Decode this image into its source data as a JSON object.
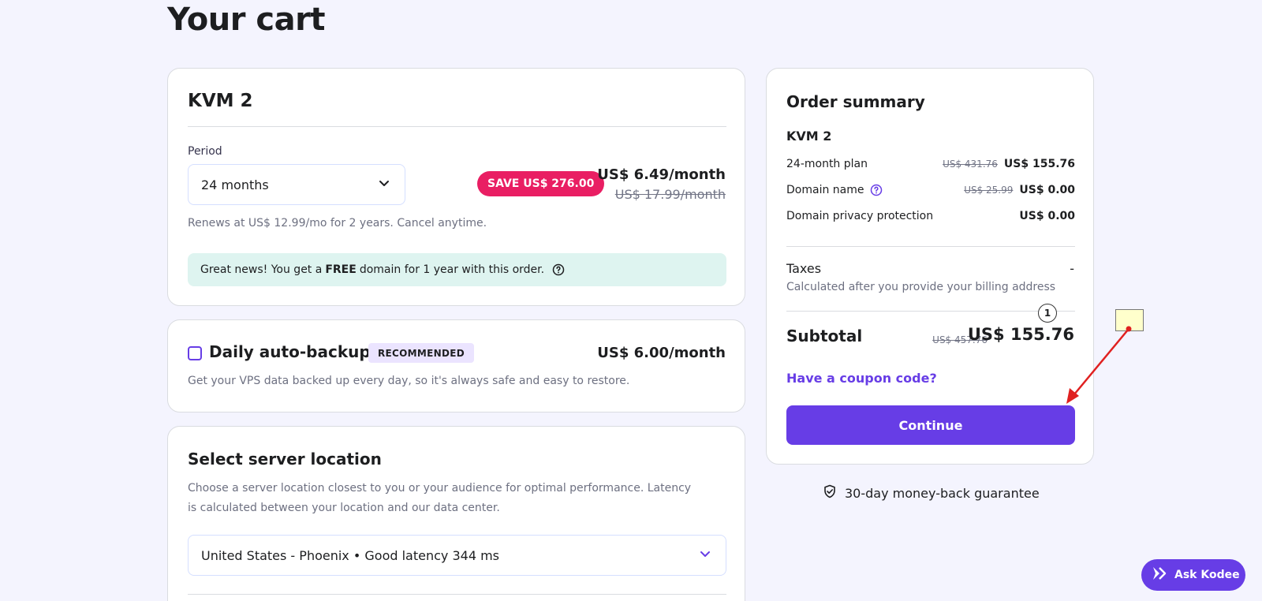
{
  "page": {
    "title": "Your cart"
  },
  "product_card": {
    "title": "KVM 2",
    "period_label": "Period",
    "period_value": "24 months",
    "save_badge": "SAVE US$ 276.00",
    "price": "US$ 6.49/month",
    "old_price": "US$ 17.99/month",
    "renews_text": "Renews at US$ 12.99/mo for 2 years. Cancel anytime.",
    "free_domain": {
      "prefix": "Great news! You get a",
      "bold": "FREE",
      "suffix": "domain for 1 year with this order."
    }
  },
  "backup_card": {
    "title": "Daily auto-backup",
    "badge": "RECOMMENDED",
    "price": "US$ 6.00/month",
    "description": "Get your VPS data backed up every day, so it's always safe and easy to restore.",
    "checked": false
  },
  "location_card": {
    "title": "Select server location",
    "description": "Choose a server location closest to you or your audience for optimal performance. Latency is calculated between your location and our data center.",
    "selected": "United States - Phoenix • Good latency 344 ms"
  },
  "summary": {
    "title": "Order summary",
    "plan_name": "KVM 2",
    "rows": [
      {
        "label": "24-month plan",
        "old": "US$ 431.76",
        "value": "US$ 155.76"
      },
      {
        "label": "Domain name",
        "old": "US$ 25.99",
        "value": "US$ 0.00"
      },
      {
        "label": "Domain privacy protection",
        "old": "",
        "value": "US$ 0.00"
      }
    ],
    "taxes_label": "Taxes",
    "taxes_value": "-",
    "taxes_note": "Calculated after you provide your billing address",
    "subtotal_label": "Subtotal",
    "subtotal_old": "US$ 457.76",
    "subtotal_value": "US$ 155.76",
    "coupon_link": "Have a coupon code?",
    "continue_label": "Continue"
  },
  "guarantee": "30-day money-back guarantee",
  "ask_kodee": "Ask Kodee",
  "annotation": {
    "marker": "1"
  },
  "colors": {
    "accent": "#673de6",
    "save_badge": "#e91e63",
    "banner": "#def4f0",
    "background": "#f4f4fe"
  }
}
